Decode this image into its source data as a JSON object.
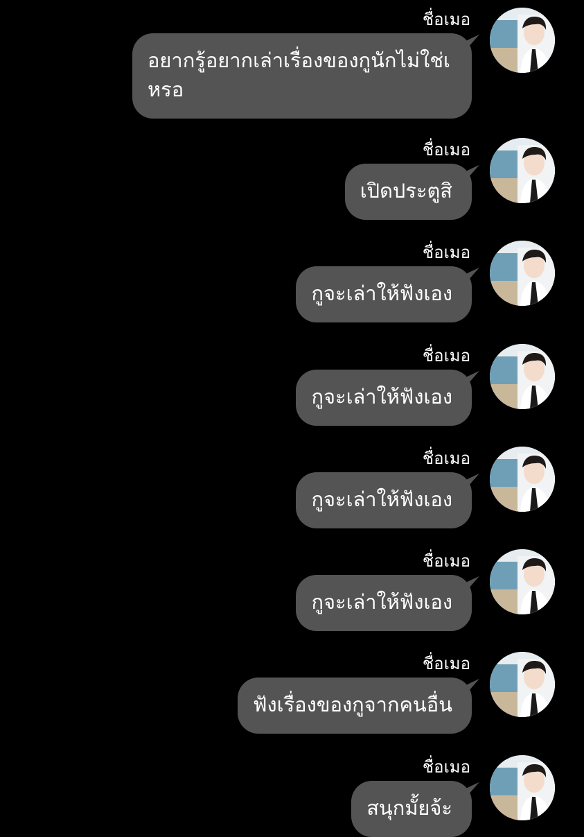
{
  "messages": [
    {
      "sender": "ชื่อเมอ",
      "text": "อยากรู้อยากเล่าเรื่องของกูนักไม่ใช่เหรอ",
      "avatar": "profile-photo"
    },
    {
      "sender": "ชื่อเมอ",
      "text": "เปิดประตูสิ",
      "avatar": "profile-photo"
    },
    {
      "sender": "ชื่อเมอ",
      "text": "กูจะเล่าให้ฟังเอง",
      "avatar": "profile-photo"
    },
    {
      "sender": "ชื่อเมอ",
      "text": "กูจะเล่าให้ฟังเอง",
      "avatar": "profile-photo"
    },
    {
      "sender": "ชื่อเมอ",
      "text": "กูจะเล่าให้ฟังเอง",
      "avatar": "profile-photo"
    },
    {
      "sender": "ชื่อเมอ",
      "text": "กูจะเล่าให้ฟังเอง",
      "avatar": "profile-photo"
    },
    {
      "sender": "ชื่อเมอ",
      "text": "ฟังเรื่องของกูจากคนอื่น",
      "avatar": "profile-photo"
    },
    {
      "sender": "ชื่อเมอ",
      "text": "สนุกมั้ยจ้ะ",
      "avatar": "profile-photo"
    }
  ],
  "colors": {
    "background": "#000000",
    "bubble": "#545454",
    "text": "#ffffff"
  }
}
